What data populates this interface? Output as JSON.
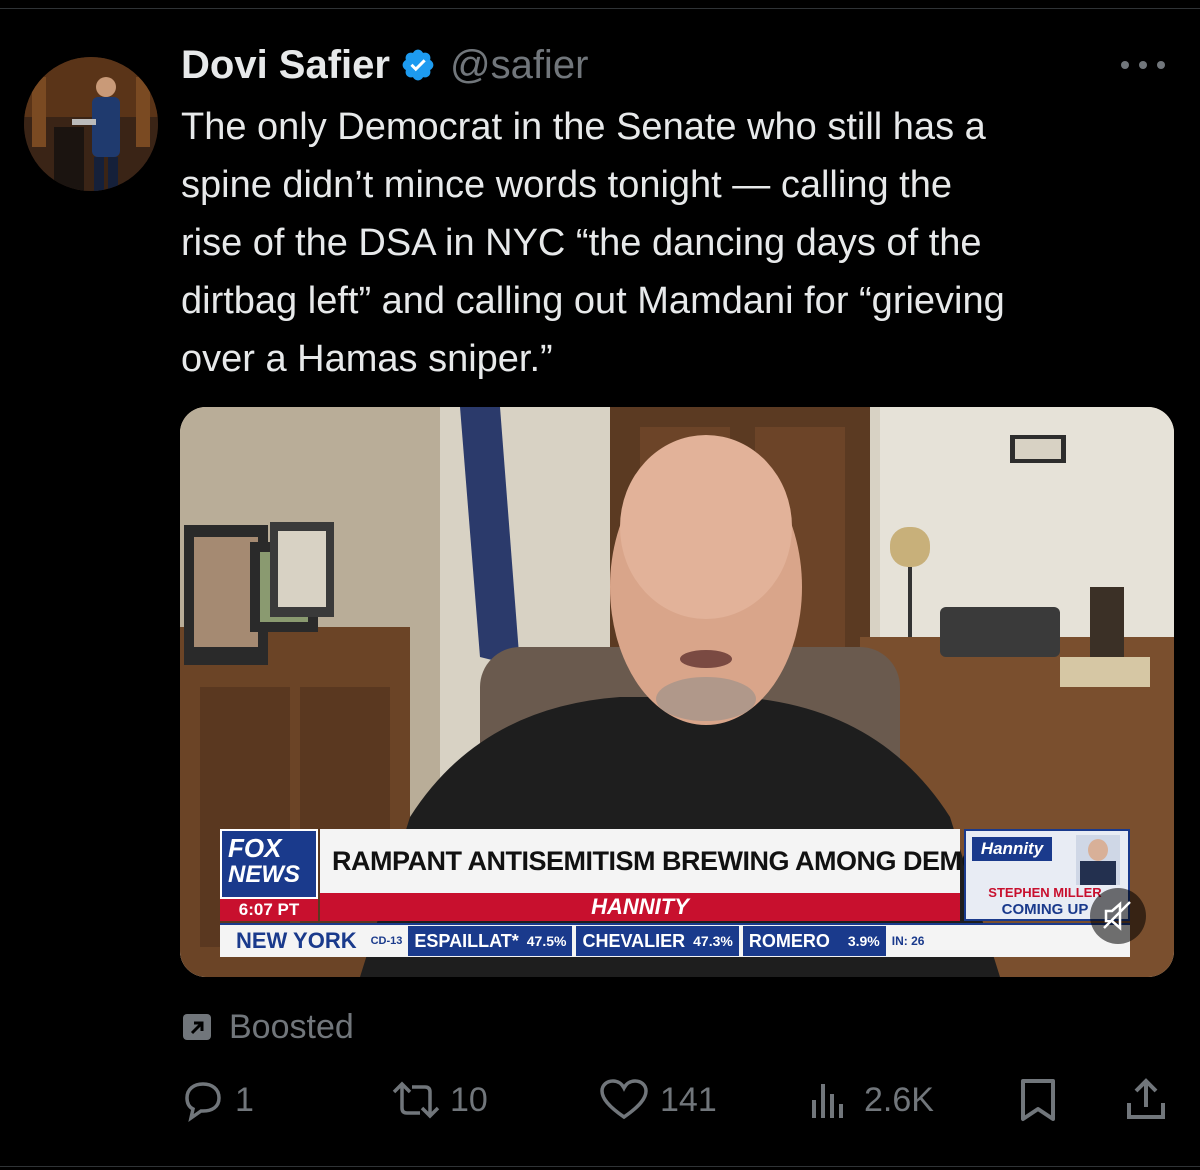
{
  "post": {
    "author_name": "Dovi Safier",
    "author_handle": "@safier",
    "text": "The only Democrat in the Senate who still has a\nspine didn’t mince words tonight — calling the\nrise of the DSA in NYC “the dancing days of the\ndirtbag left” and calling out Mamdani for “grieving\nover a Hamas sniper.”",
    "more_icon": "more-horizontal-icon",
    "verified_icon": "verified-badge-icon"
  },
  "media": {
    "network_logo_top": "FOX",
    "network_logo_bottom": "NEWS",
    "time": "6:07 PT",
    "headline": "RAMPANT ANTISEMITISM BREWING AMONG DEMOCRATS",
    "show": "HANNITY",
    "show_logo": "Hannity",
    "coming_up_name": "STEPHEN MILLER",
    "coming_up_label": "COMING UP",
    "ticker_location": "NEW YORK",
    "ticker_district": "CD-13",
    "ticker_results": [
      {
        "name": "ESPAILLAT*",
        "pct": "47.5%"
      },
      {
        "name": "CHEVALIER",
        "pct": "47.3%"
      },
      {
        "name": "ROMERO",
        "pct": "3.9%"
      }
    ],
    "ticker_in": "IN: 26",
    "mute_icon": "muted-speaker-icon"
  },
  "boosted": {
    "label": "Boosted",
    "icon": "boost-arrow-icon"
  },
  "actions": {
    "replies": "1",
    "reposts": "10",
    "likes": "141",
    "views": "2.6K",
    "reply_icon": "reply-icon",
    "repost_icon": "repost-icon",
    "like_icon": "heart-icon",
    "views_icon": "views-bar-chart-icon",
    "bookmark_icon": "bookmark-icon",
    "share_icon": "share-icon"
  },
  "colors": {
    "background": "#000000",
    "text": "#e7e9ea",
    "muted": "#71767b",
    "verified": "#1d9bf0",
    "fox_blue": "#1a3a8c",
    "fox_red": "#c8102e"
  }
}
